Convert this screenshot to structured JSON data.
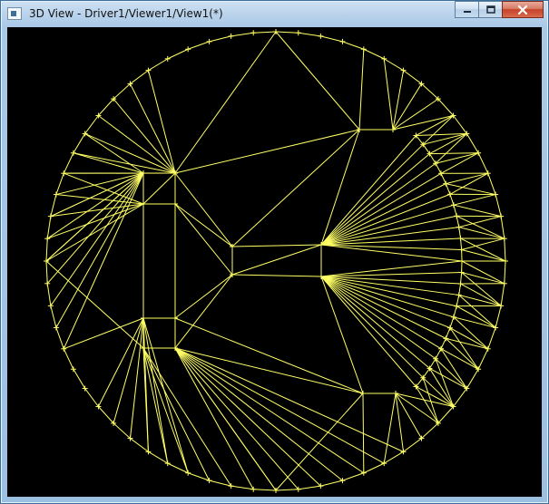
{
  "window": {
    "title": "3D View - Driver1/Viewer1/View1(*)"
  },
  "titlebar": {
    "app_icon": "window-app-icon",
    "buttons": [
      {
        "name": "minimize",
        "icon": "minimize-icon"
      },
      {
        "name": "maximize",
        "icon": "maximize-icon"
      },
      {
        "name": "close",
        "icon": "close-icon"
      }
    ]
  },
  "viewport": {
    "background": "#000000",
    "mesh_color": "#ffff66",
    "content": "wireframe-mesh"
  },
  "colors": {
    "titlebar": "#b7d1ea",
    "close_button": "#c7422a",
    "frame": "#3c6e99"
  }
}
